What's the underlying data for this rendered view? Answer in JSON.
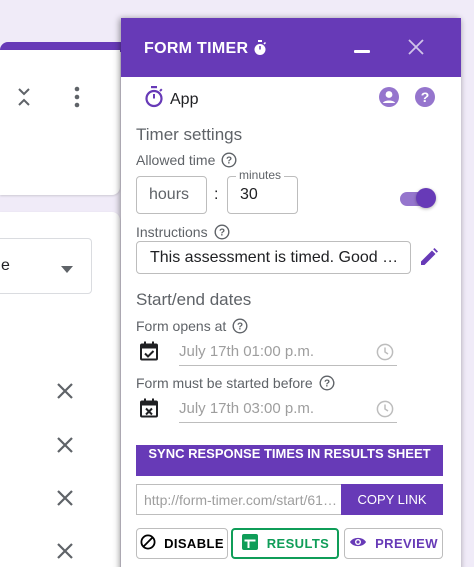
{
  "background_form": {
    "select_value": "e",
    "remove_icons": [
      "close-icon",
      "close-icon",
      "close-icon",
      "close-icon"
    ]
  },
  "panel": {
    "title": "FORM TIMER",
    "app_label": "App",
    "timer_settings": {
      "heading": "Timer settings",
      "allowed_time_label": "Allowed time",
      "hours_placeholder": "hours",
      "colon": ":",
      "minutes_label": "minutes",
      "minutes_value": "30",
      "timer_enabled": true
    },
    "instructions": {
      "label": "Instructions",
      "value": "This assessment is timed. Good …"
    },
    "dates": {
      "heading": "Start/end dates",
      "opens_label": "Form opens at",
      "opens_value": "July 17th 01:00 p.m.",
      "must_start_label": "Form must be started before",
      "must_start_value": "July 17th 03:00 p.m."
    },
    "sync_button": "SYNC RESPONSE TIMES IN RESULTS SHEET",
    "url_value": "http://form-timer.com/start/61…",
    "copy_link": "COPY LINK",
    "actions": {
      "disable": "DISABLE",
      "results": "RESULTS",
      "preview": "PREVIEW"
    }
  },
  "colors": {
    "brand": "#673ab7",
    "toggle_track": "#9575cd",
    "results_green": "#0f9d58",
    "text_muted": "#5f6368"
  }
}
